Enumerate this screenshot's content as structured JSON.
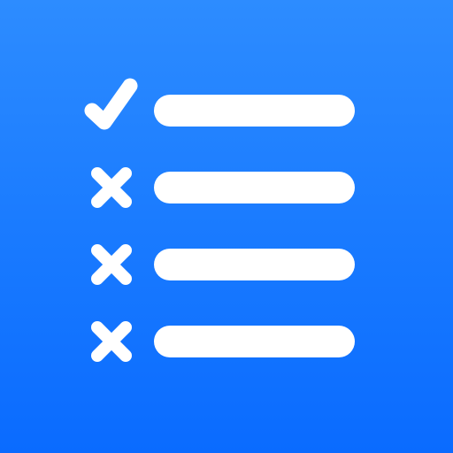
{
  "app_icon": {
    "icon": "checklist-icon",
    "background_colors": [
      "#2d8cff",
      "#0a6bff"
    ],
    "foreground_color": "#ffffff",
    "rows": [
      {
        "status": "checked",
        "icon": "checkmark-icon"
      },
      {
        "status": "unchecked",
        "icon": "x-mark-icon"
      },
      {
        "status": "unchecked",
        "icon": "x-mark-icon"
      },
      {
        "status": "unchecked",
        "icon": "x-mark-icon"
      }
    ]
  }
}
